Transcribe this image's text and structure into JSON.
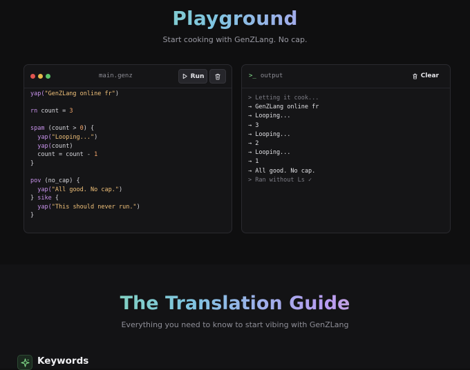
{
  "hero": {
    "title": "Playground",
    "subtitle": "Start cooking with GenZLang. No cap."
  },
  "editor": {
    "filename": "main.genz",
    "run_label": "Run",
    "window_dot_colors": [
      "#e0554f",
      "#e5b94a",
      "#5bc46a"
    ],
    "code": [
      [
        {
          "t": "yap(",
          "c": "kw"
        },
        {
          "t": "\"GenZLang online fr\"",
          "c": "str"
        },
        {
          "t": ")",
          "c": ""
        }
      ],
      [],
      [
        {
          "t": "rn",
          "c": "kw"
        },
        {
          "t": " count = ",
          "c": ""
        },
        {
          "t": "3",
          "c": "num"
        }
      ],
      [],
      [
        {
          "t": "spam",
          "c": "kw"
        },
        {
          "t": " (count > ",
          "c": ""
        },
        {
          "t": "0",
          "c": "num"
        },
        {
          "t": ") {",
          "c": ""
        }
      ],
      [
        {
          "t": "  ",
          "c": ""
        },
        {
          "t": "yap(",
          "c": "kw"
        },
        {
          "t": "\"Looping...\"",
          "c": "str"
        },
        {
          "t": ")",
          "c": ""
        }
      ],
      [
        {
          "t": "  ",
          "c": ""
        },
        {
          "t": "yap(",
          "c": "kw"
        },
        {
          "t": "count)",
          "c": ""
        }
      ],
      [
        {
          "t": "  count = count - ",
          "c": ""
        },
        {
          "t": "1",
          "c": "num"
        }
      ],
      [
        {
          "t": "}",
          "c": ""
        }
      ],
      [],
      [
        {
          "t": "pov",
          "c": "kw"
        },
        {
          "t": " (no_cap) {",
          "c": ""
        }
      ],
      [
        {
          "t": "  ",
          "c": ""
        },
        {
          "t": "yap(",
          "c": "kw"
        },
        {
          "t": "\"All good. No cap.\"",
          "c": "str"
        },
        {
          "t": ")",
          "c": ""
        }
      ],
      [
        {
          "t": "} ",
          "c": ""
        },
        {
          "t": "sike",
          "c": "kw"
        },
        {
          "t": " {",
          "c": ""
        }
      ],
      [
        {
          "t": "  ",
          "c": ""
        },
        {
          "t": "yap(",
          "c": "kw"
        },
        {
          "t": "\"This should never run.\"",
          "c": "str"
        },
        {
          "t": ")",
          "c": ""
        }
      ],
      [
        {
          "t": "}",
          "c": ""
        }
      ]
    ]
  },
  "output": {
    "prompt_icon": ">_",
    "title": "output",
    "clear_label": "Clear",
    "lines": [
      {
        "text": "> Letting it cook...",
        "kind": "sys"
      },
      {
        "text": "→ GenZLang online fr",
        "kind": "out"
      },
      {
        "text": "→ Looping...",
        "kind": "out"
      },
      {
        "text": "→ 3",
        "kind": "out"
      },
      {
        "text": "→ Looping...",
        "kind": "out"
      },
      {
        "text": "→ 2",
        "kind": "out"
      },
      {
        "text": "→ Looping...",
        "kind": "out"
      },
      {
        "text": "→ 1",
        "kind": "out"
      },
      {
        "text": "→ All good. No cap.",
        "kind": "out"
      },
      {
        "text": "> Ran without Ls ✓",
        "kind": "sys"
      }
    ]
  },
  "guide": {
    "title": "The Translation Guide",
    "subtitle": "Everything you need to know to start vibing with GenZLang",
    "section_title": "Keywords"
  }
}
